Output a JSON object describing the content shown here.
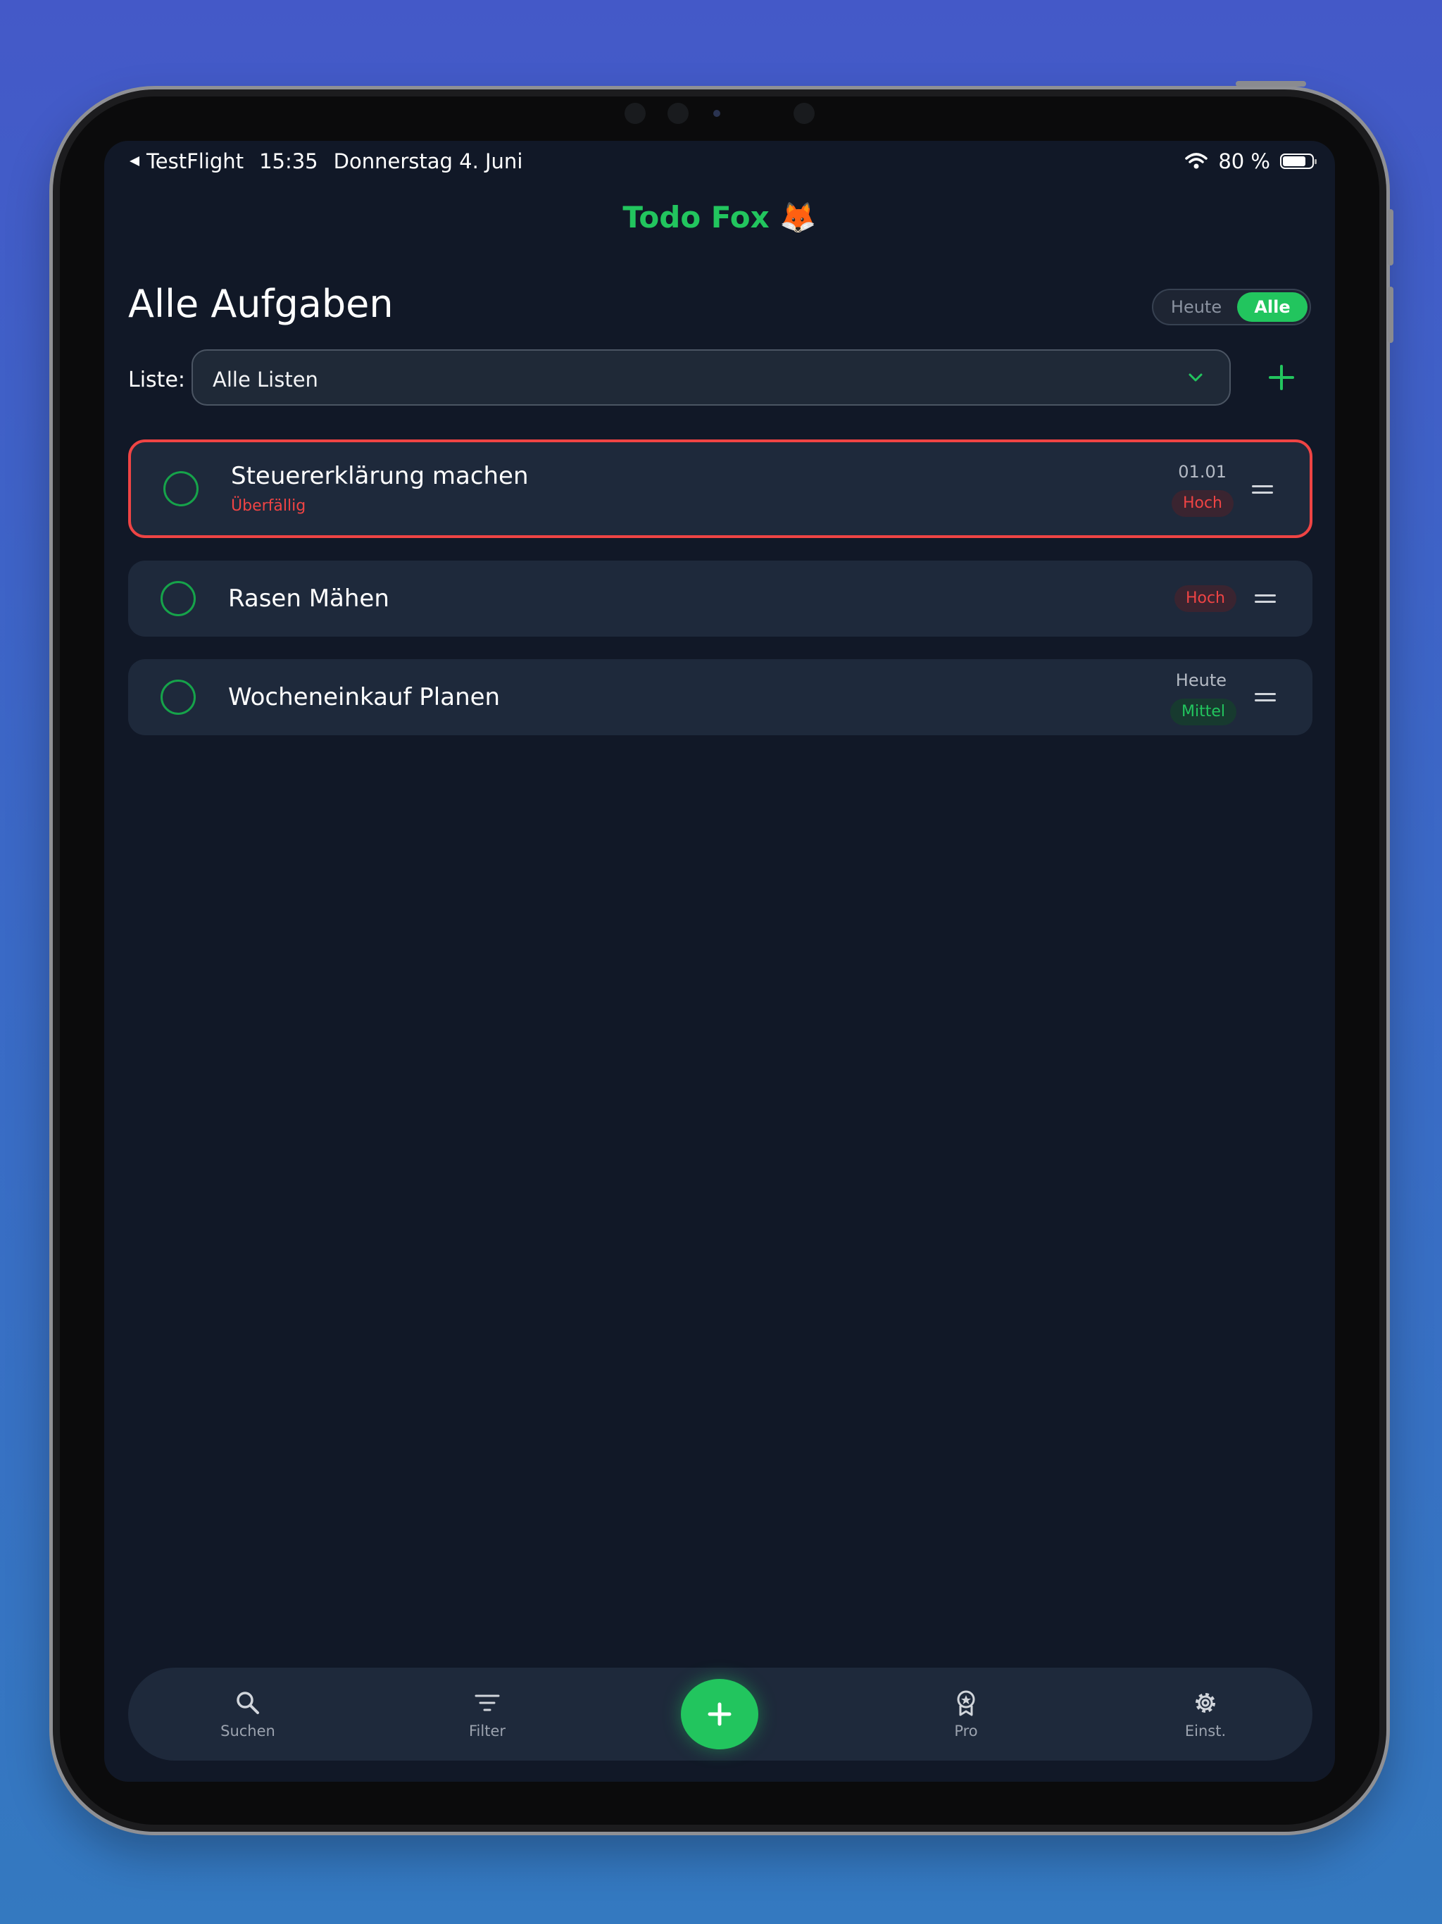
{
  "status_bar": {
    "back_app": "TestFlight",
    "time": "15:35",
    "date": "Donnerstag 4. Juni",
    "battery": "80 %",
    "battery_level": 0.8
  },
  "app": {
    "title": "Todo Fox 🦊"
  },
  "header": {
    "title": "Alle Aufgaben",
    "segment": {
      "today_label": "Heute",
      "all_label": "Alle",
      "selected": "Alle"
    }
  },
  "list_filter": {
    "label": "Liste:",
    "value": "Alle Listen"
  },
  "tasks": [
    {
      "title": "Steuererklärung machen",
      "subtitle": "Überfällig",
      "date": "01.01",
      "priority": "Hoch",
      "overdue": true
    },
    {
      "title": "Rasen Mähen",
      "subtitle": "",
      "date": "",
      "priority": "Hoch",
      "overdue": false
    },
    {
      "title": "Wocheneinkauf Planen",
      "subtitle": "",
      "date": "Heute",
      "priority": "Mittel",
      "overdue": false
    }
  ],
  "tab_bar": {
    "search": "Suchen",
    "filter": "Filter",
    "pro": "Pro",
    "settings": "Einst."
  },
  "colors": {
    "accent": "#22c55e",
    "danger": "#ef4444",
    "background": "#111827",
    "card": "#1e293b"
  }
}
